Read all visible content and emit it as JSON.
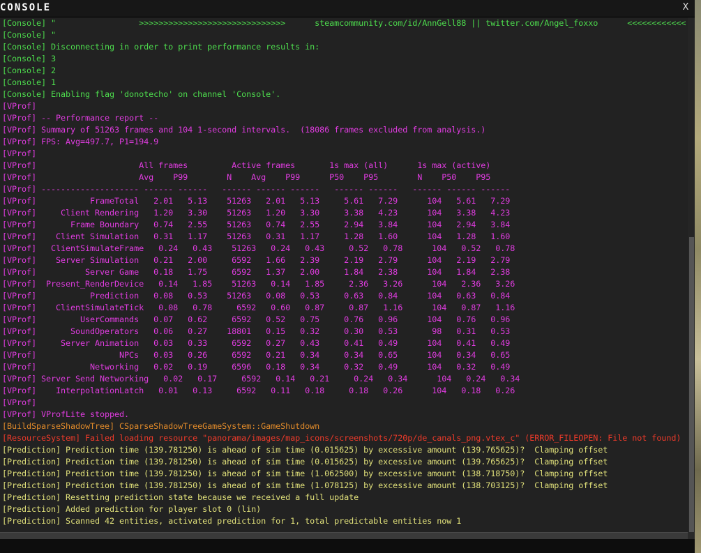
{
  "window": {
    "title": "CONSOLE",
    "close_label": "X"
  },
  "colors": {
    "console": "#4ddc4d",
    "vprof": "#e03ce0",
    "build": "#e08a2a",
    "resource": "#ee3a2a",
    "prediction": "#e0e07a"
  },
  "lines": [
    {
      "text": "[Console] \"                 >>>>>>>>>>>>>>>>>>>>>>>>>>>>>>      steamcommunity.com/id/AnnGell88 || twitter.com/Angel_foxxo      <<<<<<<<<<<<",
      "kind": "console"
    },
    {
      "text": "[Console] \"",
      "kind": "console"
    },
    {
      "text": "[Console] Disconnecting in order to print performance results in:",
      "kind": "console"
    },
    {
      "text": "[Console] 3",
      "kind": "console"
    },
    {
      "text": "[Console] 2",
      "kind": "console"
    },
    {
      "text": "[Console] 1",
      "kind": "console"
    },
    {
      "text": "[Console] Enabling flag 'donotecho' on channel 'Console'.",
      "kind": "console"
    },
    {
      "text": "[VProf]",
      "kind": "vprof"
    },
    {
      "text": "[VProf] -- Performance report --",
      "kind": "vprof"
    },
    {
      "text": "[VProf] Summary of 51263 frames and 104 1-second intervals.  (18086 frames excluded from analysis.)",
      "kind": "vprof"
    },
    {
      "text": "[VProf] FPS: Avg=497.7, P1=194.9",
      "kind": "vprof"
    },
    {
      "text": "[VProf]",
      "kind": "vprof"
    },
    {
      "text": "[VProf]                     All frames         Active frames       1s max (all)      1s max (active)",
      "kind": "vprof"
    },
    {
      "text": "[VProf]                     Avg    P99        N    Avg    P99      P50    P95        N    P50    P95",
      "kind": "vprof"
    },
    {
      "text": "[VProf] -------------------- ------ ------   ------ ------ ------   ------ ------   ------ ------ ------",
      "kind": "vprof"
    },
    {
      "text": "[VProf]           FrameTotal   2.01   5.13    51263   2.01   5.13     5.61   7.29      104   5.61   7.29",
      "kind": "vprof"
    },
    {
      "text": "[VProf]     Client Rendering   1.20   3.30    51263   1.20   3.30     3.38   4.23      104   3.38   4.23",
      "kind": "vprof"
    },
    {
      "text": "[VProf]       Frame Boundary   0.74   2.55    51263   0.74   2.55     2.94   3.84      104   2.94   3.84",
      "kind": "vprof"
    },
    {
      "text": "[VProf]    Client Simulation   0.31   1.17    51263   0.31   1.17     1.28   1.60      104   1.28   1.60",
      "kind": "vprof"
    },
    {
      "text": "[VProf]   ClientSimulateFrame   0.24   0.43    51263   0.24   0.43     0.52   0.78      104   0.52   0.78",
      "kind": "vprof"
    },
    {
      "text": "[VProf]    Server Simulation   0.21   2.00     6592   1.66   2.39     2.19   2.79      104   2.19   2.79",
      "kind": "vprof"
    },
    {
      "text": "[VProf]          Server Game   0.18   1.75     6592   1.37   2.00     1.84   2.38      104   1.84   2.38",
      "kind": "vprof"
    },
    {
      "text": "[VProf]  Present_RenderDevice   0.14   1.85    51263   0.14   1.85     2.36   3.26      104   2.36   3.26",
      "kind": "vprof"
    },
    {
      "text": "[VProf]           Prediction   0.08   0.53    51263   0.08   0.53     0.63   0.84      104   0.63   0.84",
      "kind": "vprof"
    },
    {
      "text": "[VProf]    ClientSimulateTick   0.08   0.78     6592   0.60   0.87     0.87   1.16      104   0.87   1.16",
      "kind": "vprof"
    },
    {
      "text": "[VProf]         UserCommands   0.07   0.62     6592   0.52   0.75     0.76   0.96      104   0.76   0.96",
      "kind": "vprof"
    },
    {
      "text": "[VProf]       SoundOperators   0.06   0.27    18801   0.15   0.32     0.30   0.53       98   0.31   0.53",
      "kind": "vprof"
    },
    {
      "text": "[VProf]     Server Animation   0.03   0.33     6592   0.27   0.43     0.41   0.49      104   0.41   0.49",
      "kind": "vprof"
    },
    {
      "text": "[VProf]                 NPCs   0.03   0.26     6592   0.21   0.34     0.34   0.65      104   0.34   0.65",
      "kind": "vprof"
    },
    {
      "text": "[VProf]           Networking   0.02   0.19     6596   0.18   0.34     0.32   0.49      104   0.32   0.49",
      "kind": "vprof"
    },
    {
      "text": "[VProf] Server Send Networking   0.02   0.17     6592   0.14   0.21     0.24   0.34      104   0.24   0.34",
      "kind": "vprof"
    },
    {
      "text": "[VProf]    InterpolationLatch   0.01   0.13     6592   0.11   0.18     0.18   0.26      104   0.18   0.26",
      "kind": "vprof"
    },
    {
      "text": "[VProf]",
      "kind": "vprof"
    },
    {
      "text": "[VProf] VProfLite stopped.",
      "kind": "vprof"
    },
    {
      "text": "[BuildSparseShadowTree] CSparseShadowTreeGameSystem::GameShutdown",
      "kind": "build"
    },
    {
      "text": "[ResourceSystem] Failed loading resource \"panorama/images/map_icons/screenshots/720p/de_canals_png.vtex_c\" (ERROR_FILEOPEN: File not found)",
      "kind": "resource"
    },
    {
      "text": "[Prediction] Prediction time (139.781250) is ahead of sim time (0.015625) by excessive amount (139.765625)?  Clamping offset",
      "kind": "prediction"
    },
    {
      "text": "[Prediction] Prediction time (139.781250) is ahead of sim time (0.015625) by excessive amount (139.765625)?  Clamping offset",
      "kind": "prediction"
    },
    {
      "text": "[Prediction] Prediction time (139.781250) is ahead of sim time (1.062500) by excessive amount (138.718750)?  Clamping offset",
      "kind": "prediction"
    },
    {
      "text": "[Prediction] Prediction time (139.781250) is ahead of sim time (1.078125) by excessive amount (138.703125)?  Clamping offset",
      "kind": "prediction"
    },
    {
      "text": "[Prediction] Resetting prediction state because we received a full update",
      "kind": "prediction"
    },
    {
      "text": "[Prediction] Added prediction for player slot 0 (lin)",
      "kind": "prediction"
    },
    {
      "text": "[Prediction] Scanned 42 entities, activated prediction for 1, total predictable entities now 1",
      "kind": "prediction"
    }
  ]
}
